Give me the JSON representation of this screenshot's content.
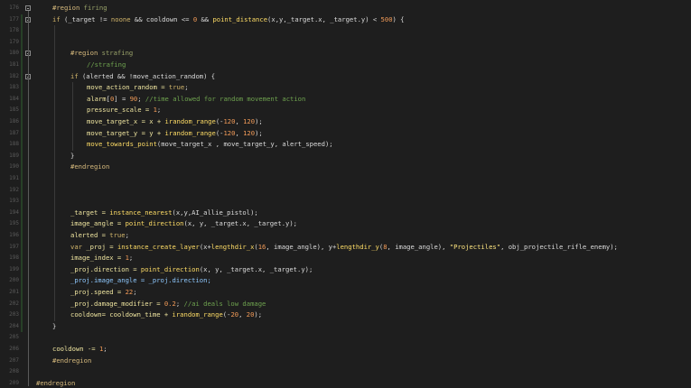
{
  "editor": {
    "line_numbers": [
      "176",
      "177",
      "178",
      "179",
      "180",
      "181",
      "182",
      "183",
      "184",
      "185",
      "186",
      "187",
      "188",
      "189",
      "190",
      "191",
      "192",
      "193",
      "194",
      "195",
      "196",
      "197",
      "198",
      "199",
      "200",
      "201",
      "202",
      "203",
      "204",
      "205",
      "206",
      "207",
      "208"
    ],
    "lines": [
      [
        {
          "t": "#region ",
          "c": "rg"
        },
        {
          "t": "firing",
          "c": "rgt"
        }
      ],
      [
        {
          "t": "if ",
          "c": "kw"
        },
        {
          "t": "(_target != ",
          "c": "op"
        },
        {
          "t": "noone",
          "c": "kw"
        },
        {
          "t": " && cooldown <= ",
          "c": "op"
        },
        {
          "t": "0",
          "c": "num"
        },
        {
          "t": " && ",
          "c": "op"
        },
        {
          "t": "point_distance",
          "c": "fn"
        },
        {
          "t": "(x,y,_target.x, _target.y) < ",
          "c": "op"
        },
        {
          "t": "500",
          "c": "num"
        },
        {
          "t": ") {",
          "c": "op"
        }
      ],
      [],
      [],
      [
        {
          "t": "#region ",
          "c": "rg"
        },
        {
          "t": "strafing",
          "c": "rgt"
        }
      ],
      [
        {
          "t": "//strafing",
          "c": "cm"
        }
      ],
      [
        {
          "t": "if ",
          "c": "kw"
        },
        {
          "t": "(alerted && !move_action_random) {",
          "c": "op"
        }
      ],
      [
        {
          "t": "move_action_random = ",
          "c": "var"
        },
        {
          "t": "true",
          "c": "kw"
        },
        {
          "t": ";",
          "c": "op"
        }
      ],
      [
        {
          "t": "alarm",
          "c": "var"
        },
        {
          "t": "[",
          "c": "op"
        },
        {
          "t": "0",
          "c": "num"
        },
        {
          "t": "] = ",
          "c": "op"
        },
        {
          "t": "90",
          "c": "num"
        },
        {
          "t": "; ",
          "c": "op"
        },
        {
          "t": "//time allowed for random movement action",
          "c": "cm"
        }
      ],
      [
        {
          "t": "pressure_scale = ",
          "c": "var"
        },
        {
          "t": "1",
          "c": "num"
        },
        {
          "t": ";",
          "c": "op"
        }
      ],
      [
        {
          "t": "move_target_x = x + ",
          "c": "var"
        },
        {
          "t": "irandom_range",
          "c": "fn"
        },
        {
          "t": "(-",
          "c": "op"
        },
        {
          "t": "120",
          "c": "num"
        },
        {
          "t": ", ",
          "c": "op"
        },
        {
          "t": "120",
          "c": "num"
        },
        {
          "t": ");",
          "c": "op"
        }
      ],
      [
        {
          "t": "move_target_y = y + ",
          "c": "var"
        },
        {
          "t": "irandom_range",
          "c": "fn"
        },
        {
          "t": "(-",
          "c": "op"
        },
        {
          "t": "120",
          "c": "num"
        },
        {
          "t": ", ",
          "c": "op"
        },
        {
          "t": "120",
          "c": "num"
        },
        {
          "t": ");",
          "c": "op"
        }
      ],
      [
        {
          "t": "move_towards_point",
          "c": "fn"
        },
        {
          "t": "(move_target_x , move_target_y, alert_speed);",
          "c": "op"
        }
      ],
      [
        {
          "t": "}",
          "c": "op"
        }
      ],
      [
        {
          "t": "#endregion",
          "c": "rg"
        }
      ],
      [],
      [],
      [],
      [
        {
          "t": "_target = ",
          "c": "var"
        },
        {
          "t": "instance_nearest",
          "c": "fn"
        },
        {
          "t": "(x,y,AI_allie_pistol);",
          "c": "op"
        }
      ],
      [
        {
          "t": "image_angle = ",
          "c": "var"
        },
        {
          "t": "point_direction",
          "c": "fn"
        },
        {
          "t": "(x, y, _target.x, _target.y);",
          "c": "op"
        }
      ],
      [
        {
          "t": "alerted = ",
          "c": "var"
        },
        {
          "t": "true",
          "c": "kw"
        },
        {
          "t": ";",
          "c": "op"
        }
      ],
      [
        {
          "t": "var ",
          "c": "kw"
        },
        {
          "t": "_proj = ",
          "c": "var"
        },
        {
          "t": "instance_create_layer",
          "c": "fn"
        },
        {
          "t": "(x+",
          "c": "op"
        },
        {
          "t": "lengthdir_x",
          "c": "fn"
        },
        {
          "t": "(",
          "c": "op"
        },
        {
          "t": "16",
          "c": "num"
        },
        {
          "t": ", image_angle), y+",
          "c": "op"
        },
        {
          "t": "lengthdir_y",
          "c": "fn"
        },
        {
          "t": "(",
          "c": "op"
        },
        {
          "t": "8",
          "c": "num"
        },
        {
          "t": ", image_angle), ",
          "c": "op"
        },
        {
          "t": "\"Projectiles\"",
          "c": "str"
        },
        {
          "t": ", obj_projectile_rifle_enemy);",
          "c": "op"
        }
      ],
      [
        {
          "t": "image_index = ",
          "c": "var"
        },
        {
          "t": "1",
          "c": "num"
        },
        {
          "t": ";",
          "c": "op"
        }
      ],
      [
        {
          "t": "_proj.direction = ",
          "c": "var"
        },
        {
          "t": "point_direction",
          "c": "fn"
        },
        {
          "t": "(x, y, _target.x, _target.y);",
          "c": "op"
        }
      ],
      [
        {
          "t": "_proj.image_angle = _proj.direction;",
          "c": "bl"
        }
      ],
      [
        {
          "t": "_proj.speed = ",
          "c": "var"
        },
        {
          "t": "22",
          "c": "num"
        },
        {
          "t": ";",
          "c": "op"
        }
      ],
      [
        {
          "t": "_proj.damage_modifier = ",
          "c": "var"
        },
        {
          "t": "0.2",
          "c": "num"
        },
        {
          "t": "; ",
          "c": "op"
        },
        {
          "t": "//ai deals low damage",
          "c": "cm"
        }
      ],
      [
        {
          "t": "cooldown= cooldown_time + ",
          "c": "var"
        },
        {
          "t": "irandom_range",
          "c": "fn"
        },
        {
          "t": "(-",
          "c": "op"
        },
        {
          "t": "20",
          "c": "num"
        },
        {
          "t": ", ",
          "c": "op"
        },
        {
          "t": "20",
          "c": "num"
        },
        {
          "t": ");",
          "c": "op"
        }
      ],
      [
        {
          "t": "}",
          "c": "op"
        }
      ],
      [],
      [
        {
          "t": "cooldown -= ",
          "c": "var"
        },
        {
          "t": "1",
          "c": "num"
        },
        {
          "t": ";",
          "c": "op"
        }
      ],
      [
        {
          "t": "#endregion",
          "c": "rg"
        }
      ],
      [],
      [
        {
          "t": "#endregion",
          "c": "rg"
        }
      ]
    ],
    "line_number_extra": [
      "209"
    ]
  }
}
